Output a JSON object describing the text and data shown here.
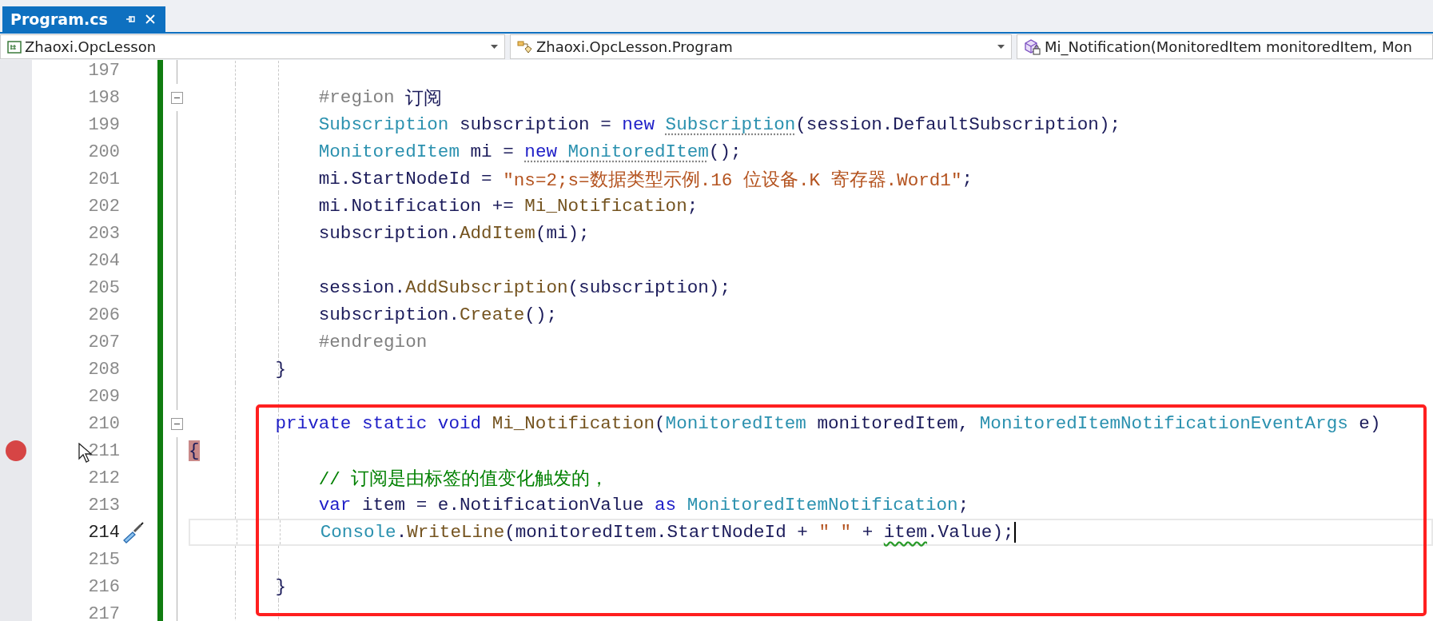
{
  "tabs": [
    {
      "label": "Program.cs",
      "selected": true
    }
  ],
  "navigation": {
    "project": "Zhaoxi.OpcLesson",
    "type": "Zhaoxi.OpcLesson.Program",
    "member": "Mi_Notification(MonitoredItem monitoredItem, Mon"
  },
  "lines": [
    {
      "number": "197"
    },
    {
      "number": "198",
      "fold": true,
      "tokens": [
        {
          "kind": "pre",
          "text": "            #region"
        },
        {
          "kind": "plain",
          "text": " 订阅"
        }
      ]
    },
    {
      "number": "199",
      "tokens": [
        {
          "kind": "type",
          "text": "            Subscription"
        },
        {
          "kind": "plain",
          "text": " subscription = "
        },
        {
          "kind": "kw",
          "text": "new "
        },
        {
          "kind": "type",
          "text": "Subscription",
          "suggestion": true
        },
        {
          "kind": "plain",
          "text": "(session.DefaultSubscription);"
        }
      ]
    },
    {
      "number": "200",
      "tokens": [
        {
          "kind": "type",
          "text": "            MonitoredItem"
        },
        {
          "kind": "plain",
          "text": " mi = "
        },
        {
          "kind": "kw",
          "text": "new ",
          "suggestion": true
        },
        {
          "kind": "type",
          "text": "MonitoredItem",
          "suggestion": true
        },
        {
          "kind": "plain",
          "text": "();"
        }
      ]
    },
    {
      "number": "201",
      "tokens": [
        {
          "kind": "plain",
          "text": "            mi.StartNodeId = "
        },
        {
          "kind": "str",
          "text": "\"ns=2;s=数据类型示例.16 位设备.K 寄存器.Word1\""
        },
        {
          "kind": "plain",
          "text": ";"
        }
      ]
    },
    {
      "number": "202",
      "tokens": [
        {
          "kind": "plain",
          "text": "            mi.Notification += "
        },
        {
          "kind": "method",
          "text": "Mi_Notification"
        },
        {
          "kind": "plain",
          "text": ";"
        }
      ]
    },
    {
      "number": "203",
      "tokens": [
        {
          "kind": "plain",
          "text": "            subscription."
        },
        {
          "kind": "method",
          "text": "AddItem"
        },
        {
          "kind": "plain",
          "text": "(mi);"
        }
      ]
    },
    {
      "number": "204"
    },
    {
      "number": "205",
      "tokens": [
        {
          "kind": "plain",
          "text": "            session."
        },
        {
          "kind": "method",
          "text": "AddSubscription"
        },
        {
          "kind": "plain",
          "text": "(subscription);"
        }
      ]
    },
    {
      "number": "206",
      "tokens": [
        {
          "kind": "plain",
          "text": "            subscription."
        },
        {
          "kind": "method",
          "text": "Create"
        },
        {
          "kind": "plain",
          "text": "();"
        }
      ]
    },
    {
      "number": "207",
      "tokens": [
        {
          "kind": "pre",
          "text": "            #endregion"
        }
      ]
    },
    {
      "number": "208",
      "tokens": [
        {
          "kind": "plain",
          "text": "        }"
        }
      ]
    },
    {
      "number": "209"
    },
    {
      "number": "210",
      "fold": true,
      "tokens": [
        {
          "kind": "kw",
          "text": "        private static void "
        },
        {
          "kind": "method",
          "text": "Mi_Notification"
        },
        {
          "kind": "plain",
          "text": "("
        },
        {
          "kind": "type",
          "text": "MonitoredItem"
        },
        {
          "kind": "plain",
          "text": " monitoredItem, "
        },
        {
          "kind": "type",
          "text": "MonitoredItemNotificationEventArgs"
        },
        {
          "kind": "plain",
          "text": " e)"
        }
      ]
    },
    {
      "number": "211",
      "breakpoint": true,
      "mouse_pointer": true,
      "tokens": [
        {
          "kind": "brace",
          "text": "{"
        }
      ]
    },
    {
      "number": "212",
      "tokens": [
        {
          "kind": "comment",
          "text": "            // 订阅是由标签的值变化触发的，"
        }
      ]
    },
    {
      "number": "213",
      "tokens": [
        {
          "kind": "kw",
          "text": "            var"
        },
        {
          "kind": "plain",
          "text": " item = e.NotificationValue "
        },
        {
          "kind": "kw",
          "text": "as "
        },
        {
          "kind": "type",
          "text": "MonitoredItemNotification"
        },
        {
          "kind": "plain",
          "text": ";"
        }
      ]
    },
    {
      "number": "214",
      "current": true,
      "quick_action": true,
      "tokens": [
        {
          "kind": "type",
          "text": "            Console"
        },
        {
          "kind": "plain",
          "text": "."
        },
        {
          "kind": "method",
          "text": "WriteLine"
        },
        {
          "kind": "plain",
          "text": "(monitoredItem.StartNodeId + "
        },
        {
          "kind": "str",
          "text": "\" \""
        },
        {
          "kind": "plain",
          "text": " + "
        },
        {
          "kind": "plain",
          "text": "item",
          "squiggle": true
        },
        {
          "kind": "plain",
          "text": ".Value);"
        }
      ]
    },
    {
      "number": "215"
    },
    {
      "number": "216",
      "tokens": [
        {
          "kind": "plain",
          "text": "        }"
        }
      ]
    },
    {
      "number": "217"
    }
  ]
}
